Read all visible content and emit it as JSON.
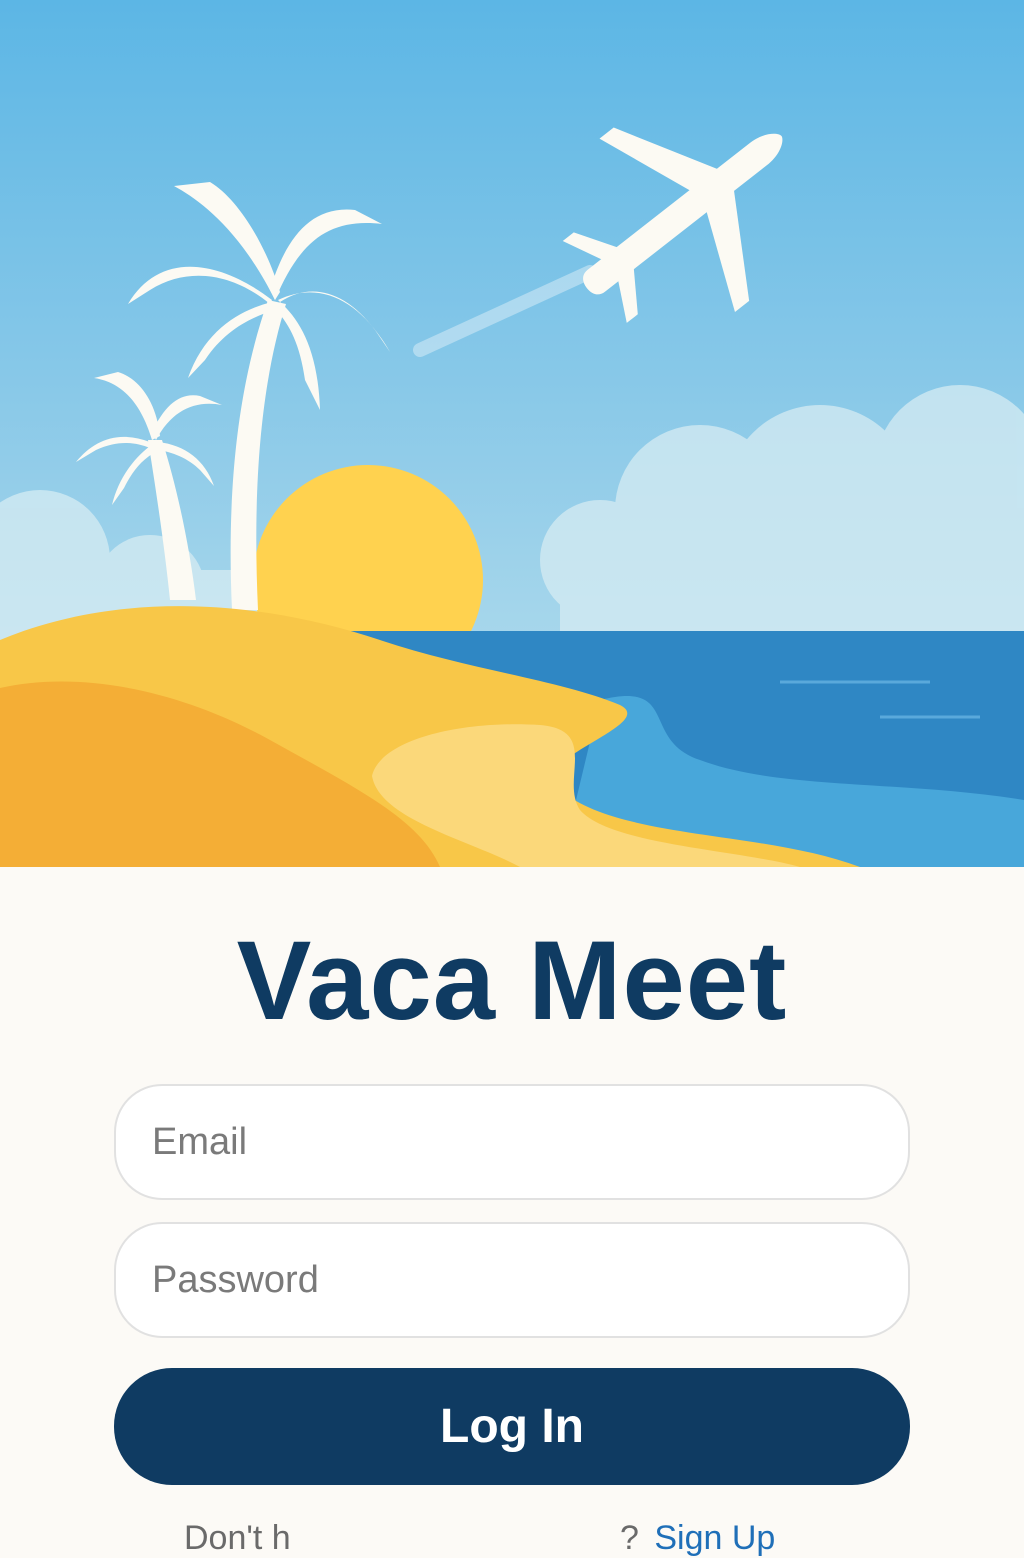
{
  "app": {
    "title": "Vaca Meet"
  },
  "login_form": {
    "email_placeholder": "Email",
    "password_placeholder": "Password",
    "submit_label": "Log In"
  },
  "footer": {
    "left_text": "Don't h",
    "right_text": "? ",
    "signup_link": "Sign Up"
  },
  "hero": {
    "icons": [
      "airplane-icon",
      "palm-tree-icon",
      "sun-icon",
      "sea",
      "beach",
      "clouds"
    ]
  },
  "colors": {
    "sky_top": "#5cb6e5",
    "sky_bottom": "#bde3ef",
    "sun": "#ffd24f",
    "sand": "#f6c843",
    "sea": "#2f8ac7",
    "brand_navy": "#0f3b62",
    "panel_bg": "#fcfaf6"
  }
}
